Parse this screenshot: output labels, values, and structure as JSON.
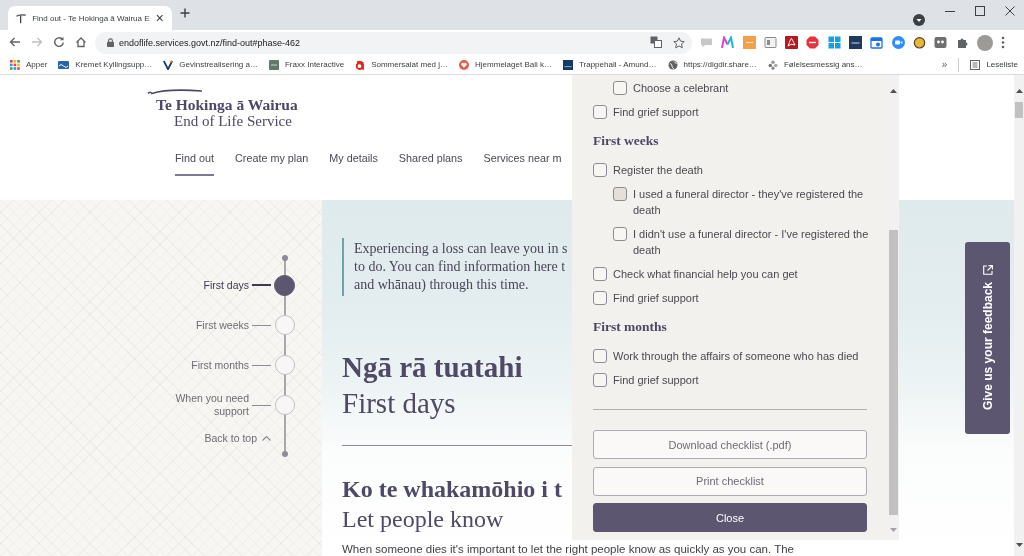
{
  "browser": {
    "tabs": [
      {
        "title": "Find out - Te Hokinga ā Wairua E",
        "selected": true
      }
    ],
    "forward": {
      "disabled": true
    },
    "url": "endoflife.services.govt.nz/find-out#phase-462",
    "bookmarks": [
      "Apper",
      "Kremet Kyllingsupp…",
      "Gevinstrealisering a…",
      "Fraxx Interactive",
      "Sommersalat med j…",
      "Hjemmelaget Bali k…",
      "Trappehall - Amund…",
      "https://digdir.share…",
      "Følelsesmessig ans…"
    ],
    "bookmarks_more": "»",
    "reading_list": "Leseliste"
  },
  "site": {
    "logo": {
      "title": "Te Hokinga ā Wairua",
      "subtitle": "End of Life Service"
    },
    "nav": [
      {
        "label": "Find out",
        "selected": true
      },
      {
        "label": "Create my plan",
        "selected": false
      },
      {
        "label": "My details",
        "selected": false
      },
      {
        "label": "Shared plans",
        "selected": false
      },
      {
        "label": "Services near m",
        "selected": false
      }
    ]
  },
  "timeline": {
    "steps": [
      {
        "label": "First days",
        "selected": true
      },
      {
        "label": "First weeks",
        "selected": false
      },
      {
        "label": "First months",
        "selected": false
      },
      {
        "label": "When you need support",
        "selected": false
      }
    ],
    "back_to_top": "Back to top"
  },
  "content": {
    "intro": "Experiencing a loss can leave you in s\nto do. You can find information here t\nand whānau) through this time.",
    "title_mi": "Ngā rā tuatahi",
    "title_en": "First days",
    "subtitle_mi": "Ko te whakamōhio i t",
    "subtitle_en": "Let people know",
    "paragraph": "When someone dies it's important to let the right people know as quickly as you can. The"
  },
  "checklist": {
    "groups": [
      {
        "items": [
          {
            "children": [
              {
                "label": "Choose a celebrant",
                "checked": false,
                "highlighted": false
              }
            ]
          },
          {
            "label": "Find grief support",
            "checked": false,
            "highlighted": false
          }
        ]
      },
      {
        "heading": "First weeks",
        "items": [
          {
            "label": "Register the death",
            "checked": false,
            "highlighted": false,
            "children": [
              {
                "label": "I used a funeral director - they've registered the death",
                "checked": false,
                "highlighted": true
              },
              {
                "label": "I didn't use a funeral director - I've registered the death",
                "checked": false,
                "highlighted": false
              }
            ]
          },
          {
            "label": "Check what financial help you can get",
            "checked": false,
            "highlighted": false
          },
          {
            "label": "Find grief support",
            "checked": false,
            "highlighted": false
          }
        ]
      },
      {
        "heading": "First months",
        "items": [
          {
            "label": "Work through the affairs of someone who has died",
            "checked": false,
            "highlighted": false
          },
          {
            "label": "Find grief support",
            "checked": false,
            "highlighted": false
          }
        ]
      }
    ],
    "buttons": [
      {
        "label": "Download checklist (.pdf)",
        "kind": "outline"
      },
      {
        "label": "Print checklist",
        "kind": "outline"
      },
      {
        "label": "Close",
        "kind": "primary"
      }
    ]
  },
  "feedback": {
    "label": "Give us your feedback"
  }
}
